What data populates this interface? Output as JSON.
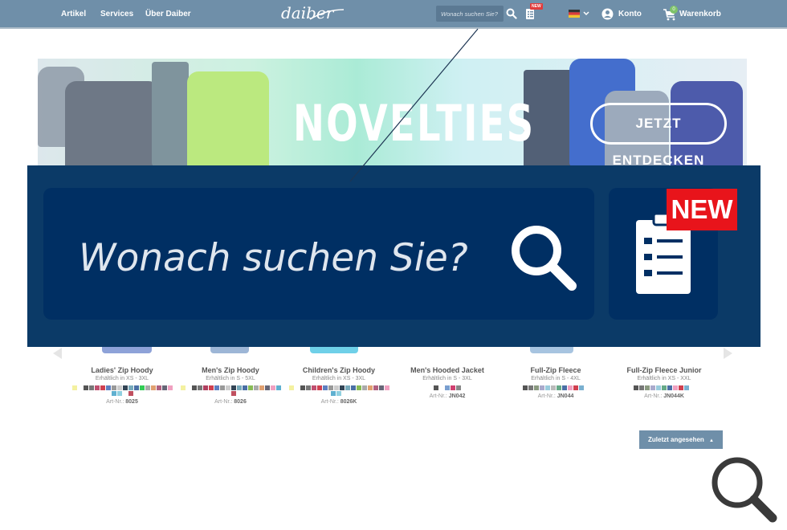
{
  "header": {
    "nav": [
      "Artikel",
      "Services",
      "Über Daiber"
    ],
    "logo": "daiber",
    "search_placeholder": "Wonach suchen Sie?",
    "new_badge": "NEW",
    "account": "Konto",
    "cart": "Warenkorb",
    "cart_count": "0"
  },
  "banner": {
    "title": "NOVELTIES",
    "cta": "JETZT ENTDECKEN"
  },
  "zoom": {
    "search_placeholder": "Wonach suchen Sie?",
    "new_badge": "NEW"
  },
  "products": [
    {
      "name": "Ladies' Zip Hoody",
      "sizes": "Erhältlich in XS - 3XL",
      "art_label": "Art-Nr.:",
      "art": "8025"
    },
    {
      "name": "Men's Zip Hoody",
      "sizes": "Erhältlich in S - 5XL",
      "art_label": "Art-Nr.:",
      "art": "8026"
    },
    {
      "name": "Children's Zip Hoody",
      "sizes": "Erhältlich in XS - 3XL",
      "art_label": "Art-Nr.:",
      "art": "8026K"
    },
    {
      "name": "Men's Hooded Jacket",
      "sizes": "Erhältlich in S - 3XL",
      "art_label": "Art-Nr.:",
      "art": "JN042"
    },
    {
      "name": "Full-Zip Fleece",
      "sizes": "Erhältlich in S - 4XL",
      "art_label": "Art-Nr.:",
      "art": "JN044"
    },
    {
      "name": "Full-Zip Fleece Junior",
      "sizes": "Erhältlich in XS - XXL",
      "art_label": "Art-Nr.:",
      "art": "JN044K"
    }
  ],
  "recently_viewed": "Zuletzt angesehen",
  "colors": {
    "header_bg": "#6f8fa9",
    "zoom_bg": "#0b3a67",
    "search_bg": "#002f63",
    "new_red": "#e8141b",
    "cart_green": "#7ec36a"
  },
  "icons": [
    "search-icon",
    "notepad-icon",
    "flag-de-icon",
    "account-icon",
    "cart-icon",
    "chevron-left-icon",
    "chevron-right-icon",
    "magnifier-icon"
  ]
}
